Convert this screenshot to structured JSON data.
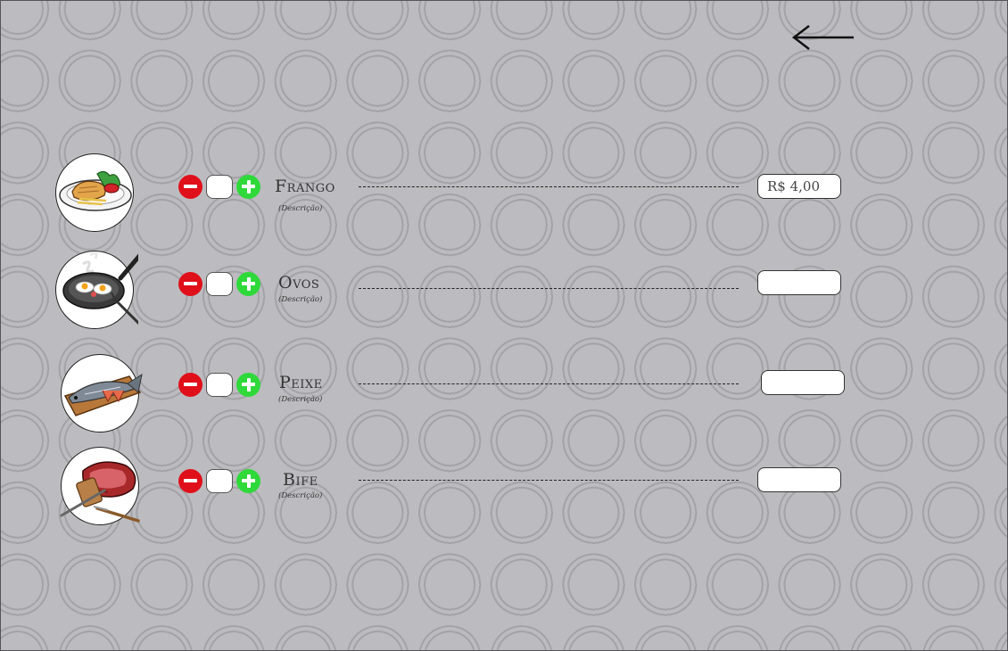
{
  "header": {
    "back_icon": "arrow-left-icon"
  },
  "colors": {
    "minus": "#e0101a",
    "plus": "#2fd93a",
    "background": "#bcbcc0"
  },
  "menu_items": [
    {
      "name": "Frango",
      "description": "(Descrição)",
      "quantity": "",
      "price": "R$ 4,00",
      "icon": "chicken-dish-icon"
    },
    {
      "name": "Ovos",
      "description": "(Descrição)",
      "quantity": "",
      "price": "",
      "icon": "eggs-pan-icon"
    },
    {
      "name": "Peixe",
      "description": "(Descrição)",
      "quantity": "",
      "price": "",
      "icon": "fish-board-icon"
    },
    {
      "name": "Bife",
      "description": "(Descrição)",
      "quantity": "",
      "price": "",
      "icon": "steak-icon"
    }
  ]
}
